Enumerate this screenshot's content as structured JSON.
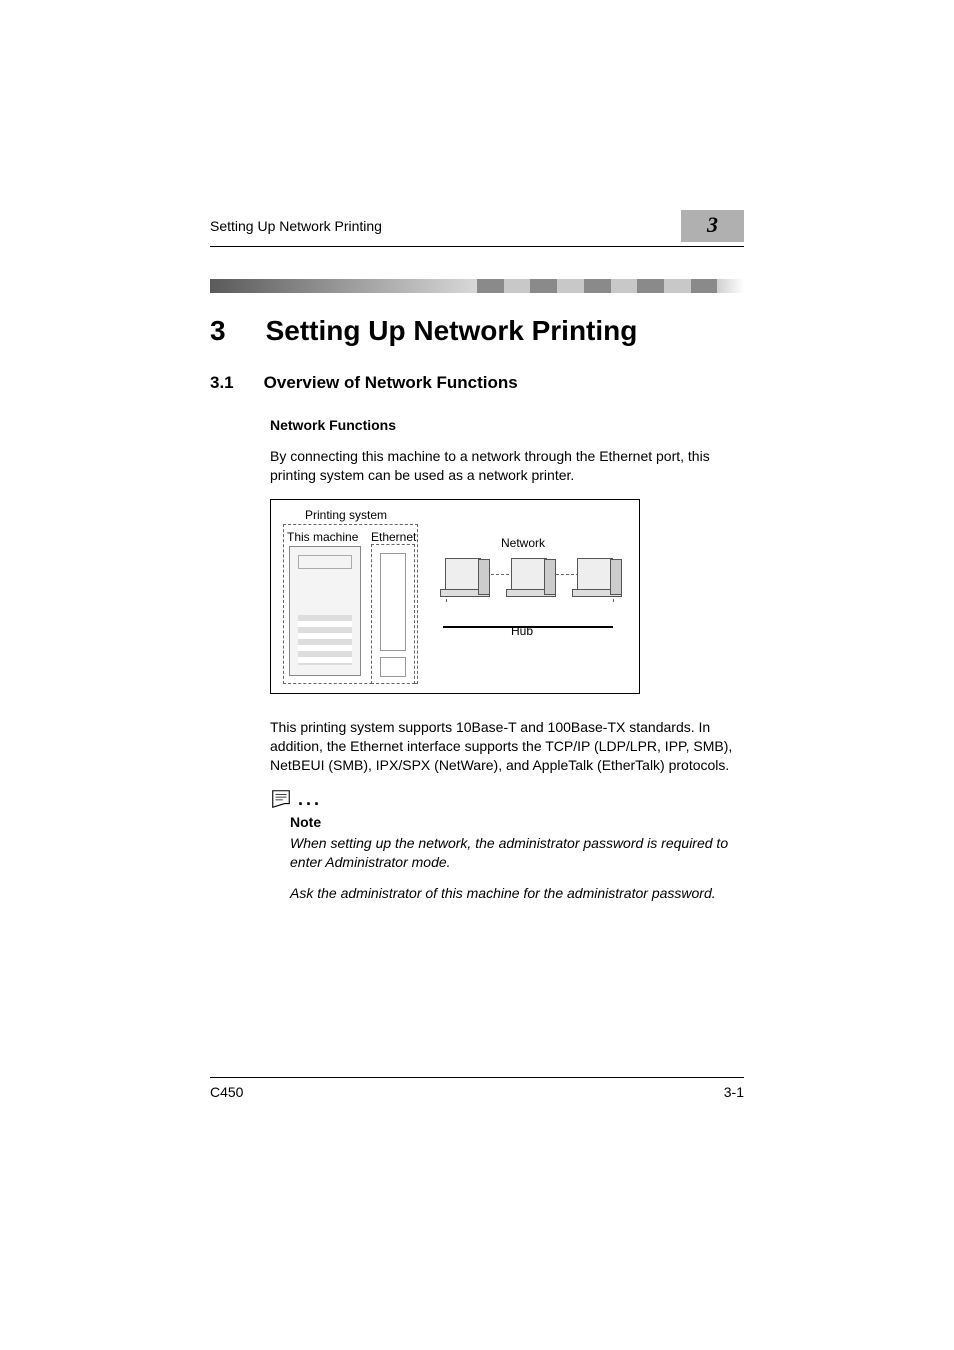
{
  "header": {
    "breadcrumb": "Setting Up Network Printing",
    "chapter_badge": "3"
  },
  "chapter": {
    "number": "3",
    "title": "Setting Up Network Printing"
  },
  "section": {
    "number": "3.1",
    "title": "Overview of Network Functions"
  },
  "subsection": {
    "title": "Network Functions"
  },
  "body": {
    "p1": "By connecting this machine to a network through the Ethernet port, this printing system can be used as a network printer.",
    "p2": "This printing system supports 10Base-T and 100Base-TX standards. In addition, the Ethernet interface supports the TCP/IP (LDP/LPR, IPP, SMB), NetBEUI (SMB), IPX/SPX (NetWare), and AppleTalk (EtherTalk) protocols."
  },
  "diagram": {
    "printing_system": "Printing system",
    "this_machine": "This machine",
    "ethernet": "Ethernet",
    "network": "Network",
    "hub": "Hub"
  },
  "note": {
    "label": "Note",
    "p1": "When setting up the network, the administrator password is required to enter Administrator mode.",
    "p2": "Ask the administrator of this machine for the administrator password."
  },
  "footer": {
    "model": "C450",
    "page": "3-1"
  }
}
